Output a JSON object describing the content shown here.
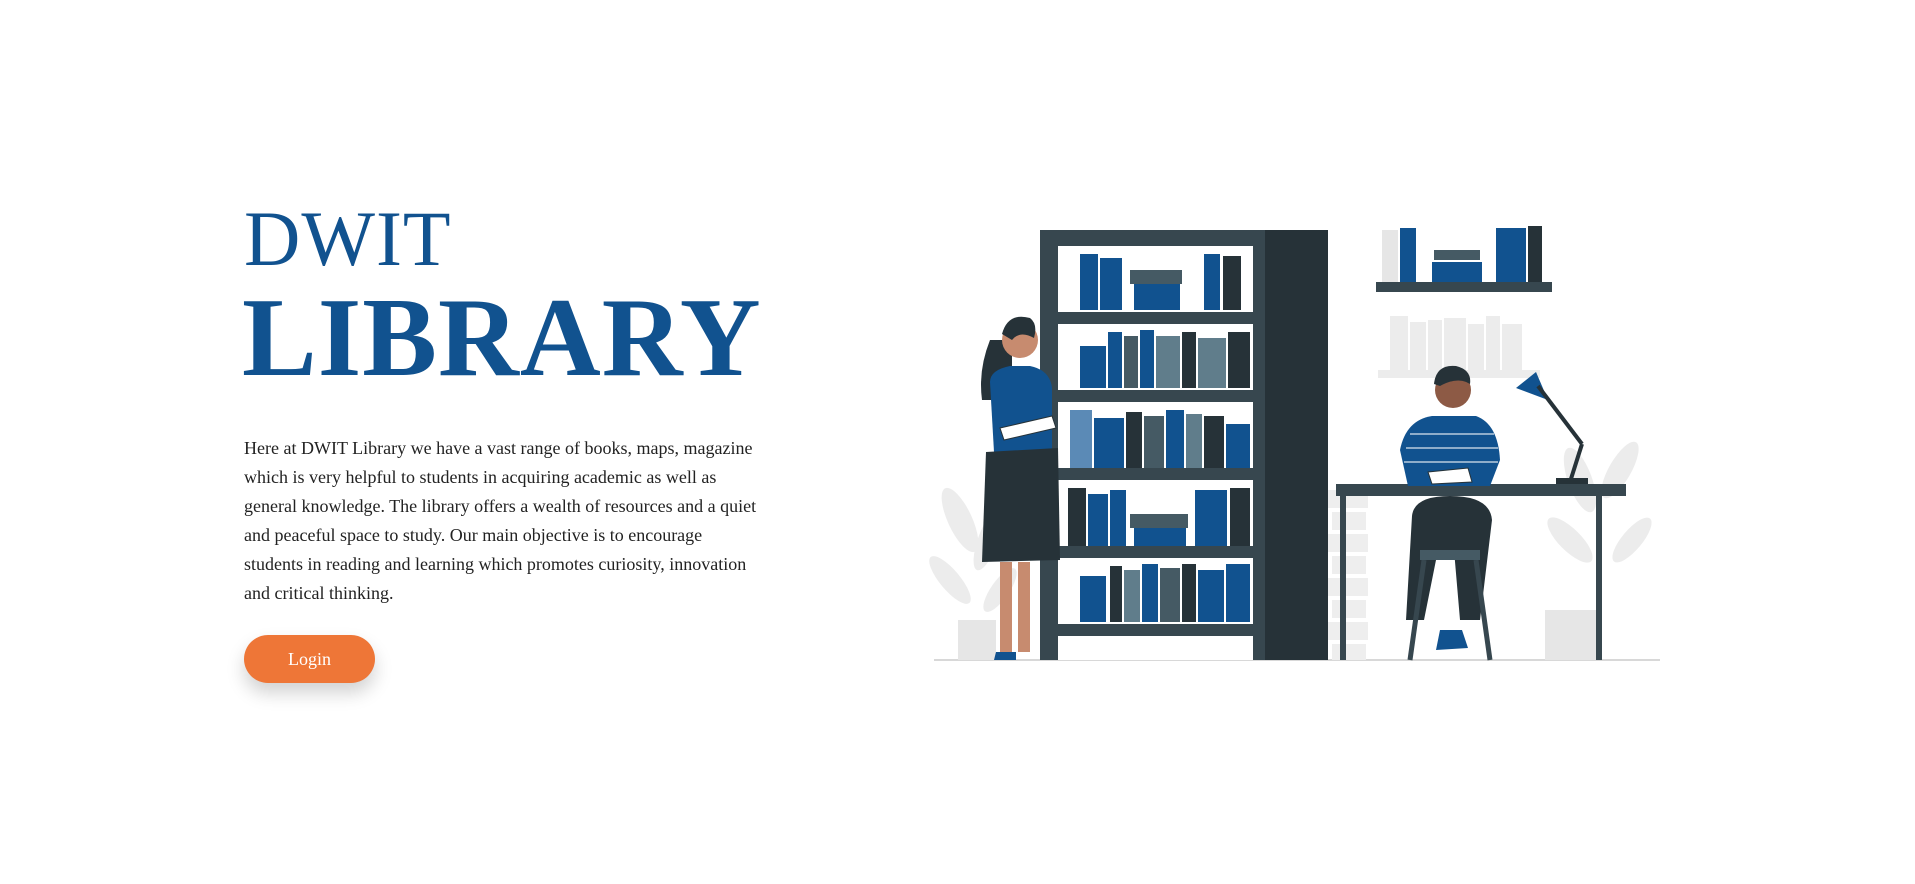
{
  "hero": {
    "title_line1": "DWIT",
    "title_line2": "LIBRARY",
    "description": "Here at DWIT Library we have a vast range of books, maps, magazine which is very helpful to students in acquiring academic as well as general knowledge. The library offers a wealth of resources and a quiet and peaceful space to study. Our main objective is to encourage students in reading and learning which promotes curiosity, innovation and critical thinking.",
    "login_label": "Login"
  },
  "colors": {
    "brand_blue": "#11528f",
    "accent_orange": "#ee7637",
    "dark_gray": "#263238",
    "light_gray": "#e0e0e0"
  },
  "illustration": {
    "subject": "library-reading-illustration"
  }
}
